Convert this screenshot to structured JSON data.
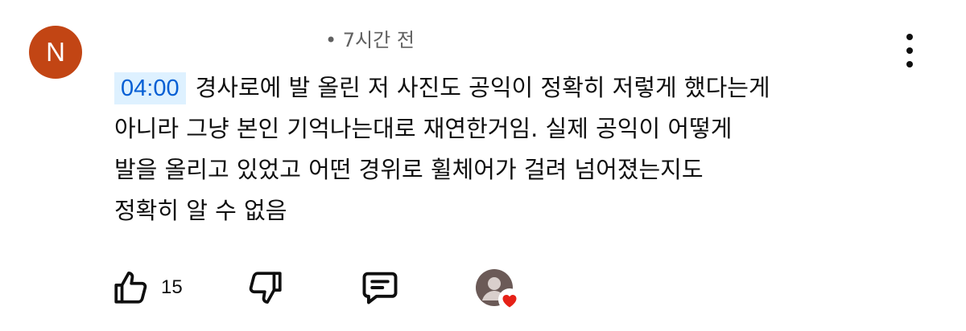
{
  "comment": {
    "avatar_letter": "N",
    "avatar_color": "#c24514",
    "time_label": "• 7시간 전",
    "timestamp_link": "04:00",
    "lines": [
      "경사로에 발 올린 저 사진도 공익이 정확히 저렇게 했다는게",
      "아니라 그냥 본인 기억나는대로 재연한거임. 실제 공익이 어떻게",
      "발을 올리고 있었고 어떤 경위로 휠체어가 걸려 넘어졌는지도",
      "정확히 알 수 없음"
    ]
  },
  "actions": {
    "like_count": "15",
    "icons": [
      "thumbs-up-icon",
      "thumbs-down-icon",
      "reply-icon",
      "creator-heart-icon",
      "more-vert-icon"
    ]
  },
  "colors": {
    "text": "#0f0f0f",
    "secondary_text": "#606060",
    "link_blue": "#065fd4",
    "timestamp_bg": "#def1ff",
    "heart_red": "#e62117"
  }
}
